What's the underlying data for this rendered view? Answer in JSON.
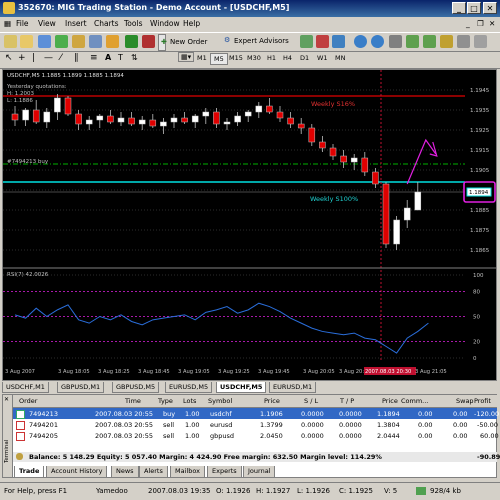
{
  "window": {
    "title": "352670: MIG Trading Station - Demo Account - [USDCHF,M5]"
  },
  "menu": [
    "File",
    "View",
    "Insert",
    "Charts",
    "Tools",
    "Window",
    "Help"
  ],
  "toolbar": {
    "new_order": "New Order",
    "expert_advisors": "Expert Advisors"
  },
  "timeframes": [
    "M1",
    "M5",
    "M15",
    "M30",
    "H1",
    "H4",
    "D1",
    "W1",
    "MN"
  ],
  "selected_timeframe": "M5",
  "chart": {
    "header": "USDCHF,M5  1.1885 1.1899 1.1885 1.1894",
    "yesterday": "Yesterday quotations:",
    "yesterday_h": "H: 1.2003",
    "yesterday_l": "L: 1.1886",
    "order_line": "#7494213 buy",
    "weekly_top": "Weekly S16%",
    "weekly_bottom": "Weekly S100%",
    "price_badge": "1.1894",
    "price_labels": [
      "1.1945",
      "1.1935",
      "1.1925",
      "1.1915",
      "1.1905",
      "1.1894",
      "1.1885",
      "1.1875",
      "1.1865"
    ],
    "rsi_title": "RSI(7) 42.0026",
    "rsi_labels": [
      "100",
      "80",
      "50",
      "20",
      "0"
    ],
    "time_labels": [
      "3 Aug 2007",
      "3 Aug 18:05",
      "3 Aug 18:25",
      "3 Aug 18:45",
      "3 Aug 19:05",
      "3 Aug 19:25",
      "3 Aug 19:45",
      "3 Aug 20:05",
      "3 Aug 20:",
      "2007.08.03 20:30",
      "3 Aug 21:05"
    ],
    "candles": [
      {
        "o": 1.1933,
        "h": 1.1937,
        "l": 1.1927,
        "c": 1.193
      },
      {
        "o": 1.193,
        "h": 1.1936,
        "l": 1.1927,
        "c": 1.1935
      },
      {
        "o": 1.1935,
        "h": 1.194,
        "l": 1.1928,
        "c": 1.1929
      },
      {
        "o": 1.1929,
        "h": 1.1936,
        "l": 1.1926,
        "c": 1.1934
      },
      {
        "o": 1.1934,
        "h": 1.1943,
        "l": 1.193,
        "c": 1.1941
      },
      {
        "o": 1.1941,
        "h": 1.1942,
        "l": 1.1932,
        "c": 1.1933
      },
      {
        "o": 1.1933,
        "h": 1.1935,
        "l": 1.1925,
        "c": 1.1928
      },
      {
        "o": 1.1928,
        "h": 1.1932,
        "l": 1.1925,
        "c": 1.193
      },
      {
        "o": 1.193,
        "h": 1.1933,
        "l": 1.1926,
        "c": 1.1932
      },
      {
        "o": 1.1932,
        "h": 1.1935,
        "l": 1.1928,
        "c": 1.1929
      },
      {
        "o": 1.1929,
        "h": 1.1934,
        "l": 1.1927,
        "c": 1.1931
      },
      {
        "o": 1.1931,
        "h": 1.1934,
        "l": 1.1927,
        "c": 1.1928
      },
      {
        "o": 1.1928,
        "h": 1.1932,
        "l": 1.1925,
        "c": 1.193
      },
      {
        "o": 1.193,
        "h": 1.1933,
        "l": 1.1926,
        "c": 1.1927
      },
      {
        "o": 1.1927,
        "h": 1.1931,
        "l": 1.1923,
        "c": 1.1929
      },
      {
        "o": 1.1929,
        "h": 1.1933,
        "l": 1.1926,
        "c": 1.1931
      },
      {
        "o": 1.1931,
        "h": 1.1934,
        "l": 1.1928,
        "c": 1.1929
      },
      {
        "o": 1.1929,
        "h": 1.1933,
        "l": 1.1926,
        "c": 1.1932
      },
      {
        "o": 1.1932,
        "h": 1.1936,
        "l": 1.1928,
        "c": 1.1934
      },
      {
        "o": 1.1934,
        "h": 1.1936,
        "l": 1.1926,
        "c": 1.1928
      },
      {
        "o": 1.1928,
        "h": 1.1931,
        "l": 1.1925,
        "c": 1.1929
      },
      {
        "o": 1.1929,
        "h": 1.1934,
        "l": 1.1927,
        "c": 1.1932
      },
      {
        "o": 1.1932,
        "h": 1.1935,
        "l": 1.1929,
        "c": 1.1934
      },
      {
        "o": 1.1934,
        "h": 1.1939,
        "l": 1.1931,
        "c": 1.1937
      },
      {
        "o": 1.1937,
        "h": 1.1941,
        "l": 1.1933,
        "c": 1.1934
      },
      {
        "o": 1.1934,
        "h": 1.1937,
        "l": 1.1929,
        "c": 1.1931
      },
      {
        "o": 1.1931,
        "h": 1.1934,
        "l": 1.1926,
        "c": 1.1928
      },
      {
        "o": 1.1928,
        "h": 1.1931,
        "l": 1.1923,
        "c": 1.1926
      },
      {
        "o": 1.1926,
        "h": 1.1928,
        "l": 1.1917,
        "c": 1.1919
      },
      {
        "o": 1.1919,
        "h": 1.1922,
        "l": 1.1914,
        "c": 1.1916
      },
      {
        "o": 1.1916,
        "h": 1.1918,
        "l": 1.191,
        "c": 1.1912
      },
      {
        "o": 1.1912,
        "h": 1.1915,
        "l": 1.1906,
        "c": 1.1909
      },
      {
        "o": 1.1909,
        "h": 1.1913,
        "l": 1.1905,
        "c": 1.1911
      },
      {
        "o": 1.1911,
        "h": 1.1914,
        "l": 1.1902,
        "c": 1.1904
      },
      {
        "o": 1.1904,
        "h": 1.1906,
        "l": 1.1896,
        "c": 1.1898
      },
      {
        "o": 1.1898,
        "h": 1.1899,
        "l": 1.1866,
        "c": 1.1868
      },
      {
        "o": 1.1868,
        "h": 1.1882,
        "l": 1.1865,
        "c": 1.188
      },
      {
        "o": 1.188,
        "h": 1.189,
        "l": 1.1876,
        "c": 1.1886
      },
      {
        "o": 1.1885,
        "h": 1.1899,
        "l": 1.1885,
        "c": 1.1894
      }
    ],
    "rsi_values": [
      52,
      48,
      60,
      50,
      58,
      64,
      46,
      42,
      50,
      46,
      52,
      44,
      40,
      46,
      48,
      50,
      52,
      46,
      55,
      58,
      62,
      54,
      58,
      66,
      62,
      56,
      48,
      42,
      36,
      32,
      30,
      28,
      30,
      24,
      22,
      14,
      6,
      24,
      32,
      42
    ]
  },
  "chart_tabs": [
    "USDCHF,M1",
    "GBPUSD,M1",
    "GBPUSD,M5",
    "EURUSD,M5",
    "USDCHF,M5",
    "EURUSD,M1"
  ],
  "selected_chart_tab": "USDCHF,M5",
  "terminal": {
    "columns": [
      "Order",
      "Time",
      "Type",
      "Lots",
      "Symbol",
      "Price",
      "S / L",
      "T / P",
      "Price",
      "Comm...",
      "Swap",
      "Profit"
    ],
    "rows": [
      [
        "7494213",
        "2007.08.03 20:55",
        "buy",
        "1.00",
        "usdchf",
        "1.1906",
        "0.0000",
        "0.0000",
        "1.1894",
        "0.00",
        "0.00",
        "-120.00"
      ],
      [
        "7494201",
        "2007.08.03 20:55",
        "sell",
        "1.00",
        "eurusd",
        "1.3799",
        "0.0000",
        "0.0000",
        "1.3804",
        "0.00",
        "0.00",
        "-50.00"
      ],
      [
        "7494205",
        "2007.08.03 20:55",
        "sell",
        "1.00",
        "gbpusd",
        "2.0450",
        "0.0000",
        "0.0000",
        "2.0444",
        "0.00",
        "0.00",
        "60.00"
      ]
    ],
    "balance": "Balance: 5 148.29  Equity: 5 057.40  Margin: 4 424.90  Free margin: 632.50  Margin level: 114.29%",
    "balance_profit": "-90.89",
    "tabs": [
      "Trade",
      "Account History",
      "News",
      "Alerts",
      "Mailbox",
      "Experts",
      "Journal"
    ],
    "side_label": "Terminal"
  },
  "status": {
    "help": "For Help, press F1",
    "profile": "Yamedoo",
    "time": "2007.08.03 19:35",
    "open": "O: 1.1926",
    "high": "H: 1.1927",
    "low": "L: 1.1926",
    "close": "C: 1.1925",
    "volume": "V: 5",
    "traffic": "928/4 kb"
  },
  "colors": {
    "bull": "#ffffff",
    "bear": "#e00000",
    "weekly_top": "#e00000",
    "weekly_bottom": "#00e0e0",
    "order_line": "#00b000",
    "annotation": "#e020e0",
    "rsi": "#2a6edb",
    "selection": "#3168c5"
  }
}
